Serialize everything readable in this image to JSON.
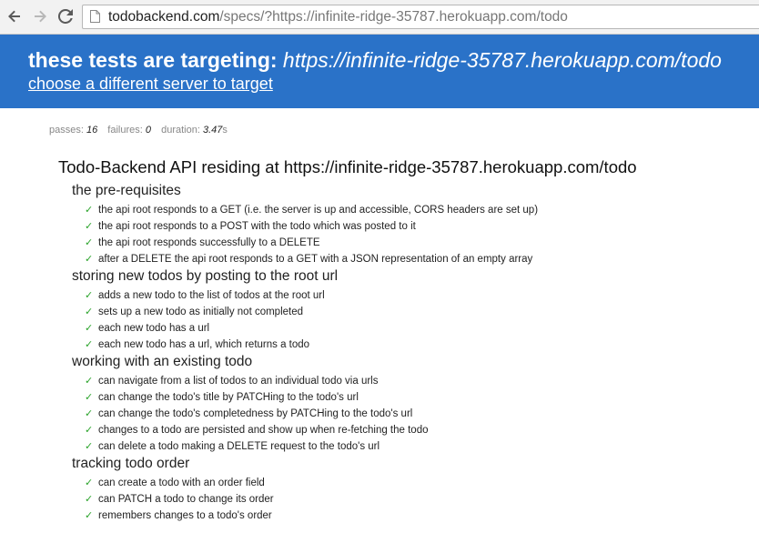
{
  "browser": {
    "url_host": "todobackend.com",
    "url_path": "/specs/?https://infinite-ridge-35787.herokuapp.com/todo",
    "icons": {
      "back": "back-arrow-icon",
      "forward": "forward-arrow-icon",
      "reload": "reload-icon",
      "page": "page-icon"
    }
  },
  "banner": {
    "label": "these tests are targeting:",
    "target": "https://infinite-ridge-35787.herokuapp.com/todo",
    "link": "choose a different server to target",
    "color": "#2a72c8"
  },
  "stats": {
    "passes_label": "passes:",
    "passes": "16",
    "failures_label": "failures:",
    "failures": "0",
    "duration_label": "duration:",
    "duration": "3.47",
    "duration_unit": "s"
  },
  "root_suite": "Todo-Backend API residing at https://infinite-ridge-35787.herokuapp.com/todo",
  "pass_mark": "✓",
  "suites": [
    {
      "title": "the pre-requisites",
      "tests": [
        "the api root responds to a GET (i.e. the server is up and accessible, CORS headers are set up)",
        "the api root responds to a POST with the todo which was posted to it",
        "the api root responds successfully to a DELETE",
        "after a DELETE the api root responds to a GET with a JSON representation of an empty array"
      ]
    },
    {
      "title": "storing new todos by posting to the root url",
      "tests": [
        "adds a new todo to the list of todos at the root url",
        "sets up a new todo as initially not completed",
        "each new todo has a url",
        "each new todo has a url, which returns a todo"
      ]
    },
    {
      "title": "working with an existing todo",
      "tests": [
        "can navigate from a list of todos to an individual todo via urls",
        "can change the todo's title by PATCHing to the todo's url",
        "can change the todo's completedness by PATCHing to the todo's url",
        "changes to a todo are persisted and show up when re-fetching the todo",
        "can delete a todo making a DELETE request to the todo's url"
      ]
    },
    {
      "title": "tracking todo order",
      "tests": [
        "can create a todo with an order field",
        "can PATCH a todo to change its order",
        "remembers changes to a todo's order"
      ]
    }
  ],
  "pass_color": "#2aa32a"
}
